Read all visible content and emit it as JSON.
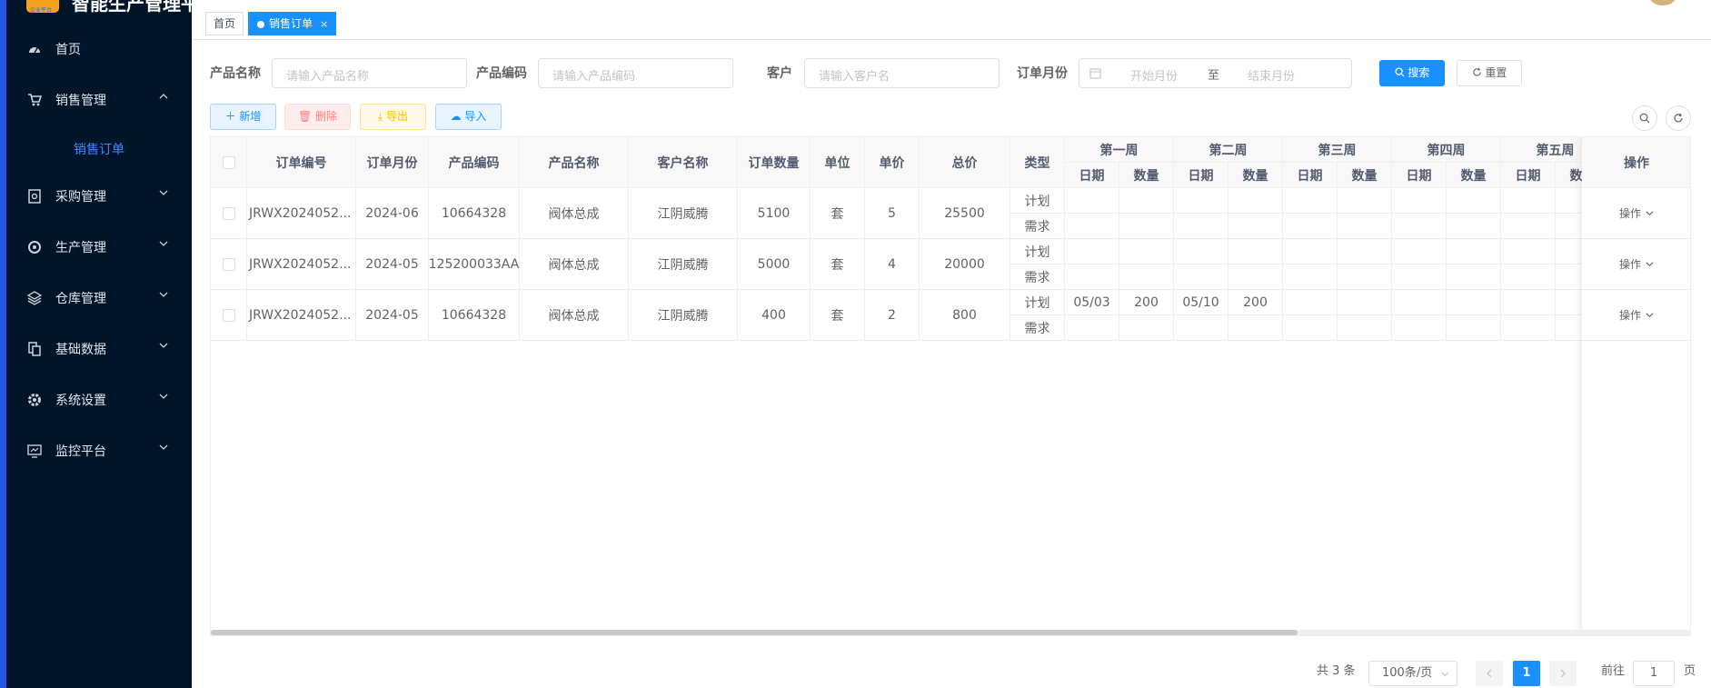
{
  "app": {
    "title": "智能生产管理平台",
    "logo_sub": "企业平台"
  },
  "sidebar": {
    "items": [
      {
        "label": "首页",
        "icon": "dashboard-icon"
      },
      {
        "label": "销售管理",
        "icon": "cart-icon"
      },
      {
        "label": "采购管理",
        "icon": "purchase-icon"
      },
      {
        "label": "生产管理",
        "icon": "production-icon"
      },
      {
        "label": "仓库管理",
        "icon": "warehouse-icon"
      },
      {
        "label": "基础数据",
        "icon": "data-icon"
      },
      {
        "label": "系统设置",
        "icon": "settings-icon"
      },
      {
        "label": "监控平台",
        "icon": "monitor-icon"
      }
    ],
    "submenu": {
      "label": "销售订单"
    }
  },
  "tags": [
    {
      "label": "首页"
    },
    {
      "label": "销售订单",
      "close": "×"
    }
  ],
  "search": {
    "product_name": {
      "label": "产品名称",
      "placeholder": "请输入产品名称"
    },
    "product_code": {
      "label": "产品编码",
      "placeholder": "请输入产品编码"
    },
    "customer": {
      "label": "客户",
      "placeholder": "请输入客户名"
    },
    "order_month": {
      "label": "订单月份",
      "start_placeholder": "开始月份",
      "separator": "至",
      "end_placeholder": "结束月份"
    },
    "search_button": "搜索",
    "reset_button": "重置"
  },
  "toolbar": {
    "add": "新增",
    "delete": "删除",
    "export": "导出",
    "import": "导入"
  },
  "table": {
    "headers": {
      "order_no": "订单编号",
      "order_month": "订单月份",
      "product_code": "产品编码",
      "product_name": "产品名称",
      "customer_name": "客户名称",
      "quantity": "订单数量",
      "unit": "单位",
      "unit_price": "单价",
      "total": "总价",
      "type": "类型",
      "actions": "操作",
      "date": "日期",
      "qty": "数量"
    },
    "weeks": [
      "第一周",
      "第二周",
      "第三周",
      "第四周",
      "第五周"
    ],
    "type_labels": [
      "计划",
      "需求"
    ],
    "action_label": "操作",
    "rows": [
      {
        "order_no": "JRWX2024052...",
        "order_month": "2024-06",
        "product_code": "10664328",
        "product_name": "阀体总成",
        "customer_name": "江阴威腾",
        "quantity": "5100",
        "unit": "套",
        "unit_price": "5",
        "total": "25500",
        "plan": [
          "",
          "",
          "",
          "",
          "",
          "",
          "",
          "",
          "",
          ""
        ],
        "demand": [
          "",
          "",
          "",
          "",
          "",
          "",
          "",
          "",
          "",
          ""
        ]
      },
      {
        "order_no": "JRWX2024052...",
        "order_month": "2024-05",
        "product_code": "125200033AA",
        "product_name": "阀体总成",
        "customer_name": "江阴威腾",
        "quantity": "5000",
        "unit": "套",
        "unit_price": "4",
        "total": "20000",
        "plan": [
          "",
          "",
          "",
          "",
          "",
          "",
          "",
          "",
          "",
          ""
        ],
        "demand": [
          "",
          "",
          "",
          "",
          "",
          "",
          "",
          "",
          "",
          ""
        ]
      },
      {
        "order_no": "JRWX2024052...",
        "order_month": "2024-05",
        "product_code": "10664328",
        "product_name": "阀体总成",
        "customer_name": "江阴威腾",
        "quantity": "400",
        "unit": "套",
        "unit_price": "2",
        "total": "800",
        "plan": [
          "05/03",
          "200",
          "05/10",
          "200",
          "",
          "",
          "",
          "",
          "",
          ""
        ],
        "demand": [
          "",
          "",
          "",
          "",
          "",
          "",
          "",
          "",
          "",
          ""
        ]
      }
    ]
  },
  "pagination": {
    "total": "共 3 条",
    "page_size": "100条/页",
    "current_page": "1",
    "goto_label": "前往",
    "goto_value": "1",
    "page_suffix": "页"
  }
}
